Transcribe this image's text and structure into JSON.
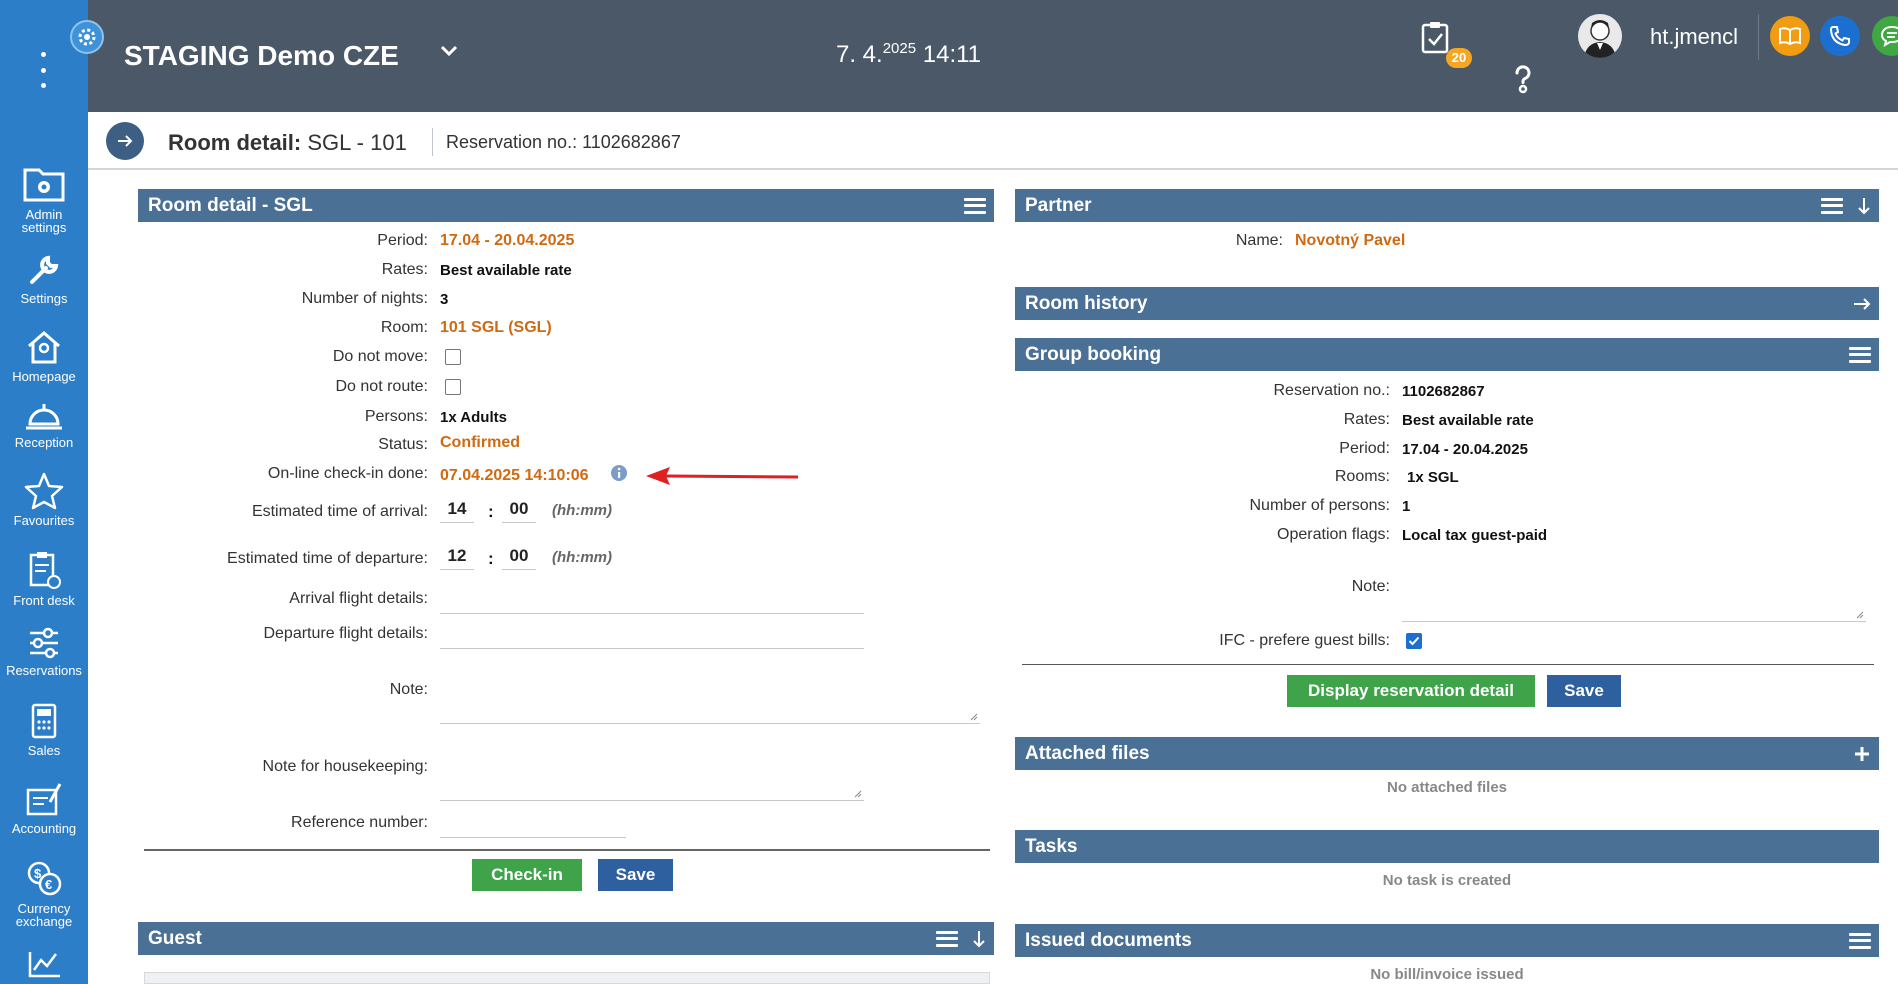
{
  "sidebar": {
    "items": [
      {
        "label": "Admin settings",
        "icon": "admin-settings-icon"
      },
      {
        "label": "Settings",
        "icon": "wrench-icon"
      },
      {
        "label": "Homepage",
        "icon": "home-icon"
      },
      {
        "label": "Reception",
        "icon": "bell-icon"
      },
      {
        "label": "Favourites",
        "icon": "star-icon"
      },
      {
        "label": "Front desk",
        "icon": "clipboard-icon"
      },
      {
        "label": "Reservations",
        "icon": "sliders-icon"
      },
      {
        "label": "Sales",
        "icon": "calculator-icon"
      },
      {
        "label": "Accounting",
        "icon": "accounting-icon"
      },
      {
        "label": "Currency exchange",
        "icon": "currency-icon"
      }
    ]
  },
  "header": {
    "title": "STAGING Demo CZE",
    "date_main": "7. 4.",
    "date_year": "2025",
    "time": "14:11",
    "tasks_badge": "20",
    "username": "ht.jmencl"
  },
  "titlebar": {
    "title_bold": "Room detail:",
    "title_rest": " SGL - 101",
    "reservation": "Reservation no.: 1102682867"
  },
  "room_detail": {
    "heading": "Room detail - SGL",
    "period_label": "Period:",
    "period": "17.04 - 20.04.2025",
    "rates_label": "Rates:",
    "rates": "Best available rate",
    "nights_label": "Number of nights:",
    "nights": "3",
    "room_label": "Room:",
    "room": "101 SGL (SGL)",
    "do_not_move_label": "Do not move:",
    "do_not_route_label": "Do not route:",
    "persons_label": "Persons:",
    "persons": "1x Adults",
    "status_label": "Status:",
    "status": "Confirmed",
    "checkin_done_label": "On-line check-in done:",
    "checkin_done": "07.04.2025 14:10:06",
    "eta_label": "Estimated time of arrival:",
    "eta_h": "14",
    "eta_m": "00",
    "etd_label": "Estimated time of departure:",
    "etd_h": "12",
    "etd_m": "00",
    "time_sep": ":",
    "time_hint": "(hh:mm)",
    "arrival_flight_label": "Arrival flight details:",
    "departure_flight_label": "Departure flight details:",
    "note_label": "Note:",
    "housekeeping_label": "Note for housekeeping:",
    "reference_label": "Reference number:",
    "checkin_button": "Check-in",
    "save_button": "Save"
  },
  "guest": {
    "heading": "Guest"
  },
  "partner": {
    "heading": "Partner",
    "name_label": "Name:",
    "name": "Novotný Pavel"
  },
  "room_history": {
    "heading": "Room history"
  },
  "group_booking": {
    "heading": "Group booking",
    "reservation_label": "Reservation no.:",
    "reservation": "1102682867",
    "rates_label": "Rates:",
    "rates": "Best available rate",
    "period_label": "Period:",
    "period": "17.04 - 20.04.2025",
    "rooms_label": "Rooms:",
    "rooms": "1x SGL",
    "persons_label": "Number of persons:",
    "persons": "1",
    "flags_label": "Operation flags:",
    "flags": "Local tax guest-paid",
    "note_label": "Note:",
    "ifc_label": "IFC - prefere guest bills:",
    "display_button": "Display reservation detail",
    "save_button": "Save"
  },
  "attached_files": {
    "heading": "Attached files",
    "empty": "No attached files"
  },
  "tasks": {
    "heading": "Tasks",
    "empty": "No task is created"
  },
  "issued_documents": {
    "heading": "Issued documents",
    "empty": "No bill/invoice issued"
  },
  "colors": {
    "sidebar": "#2d7ec9",
    "header": "#4a5868",
    "panel_head": "#4a7096",
    "accent_orange": "#cf6a12",
    "green_button": "#3fa34a",
    "blue_button": "#2e5f9e",
    "annotation_arrow": "#e02020"
  }
}
